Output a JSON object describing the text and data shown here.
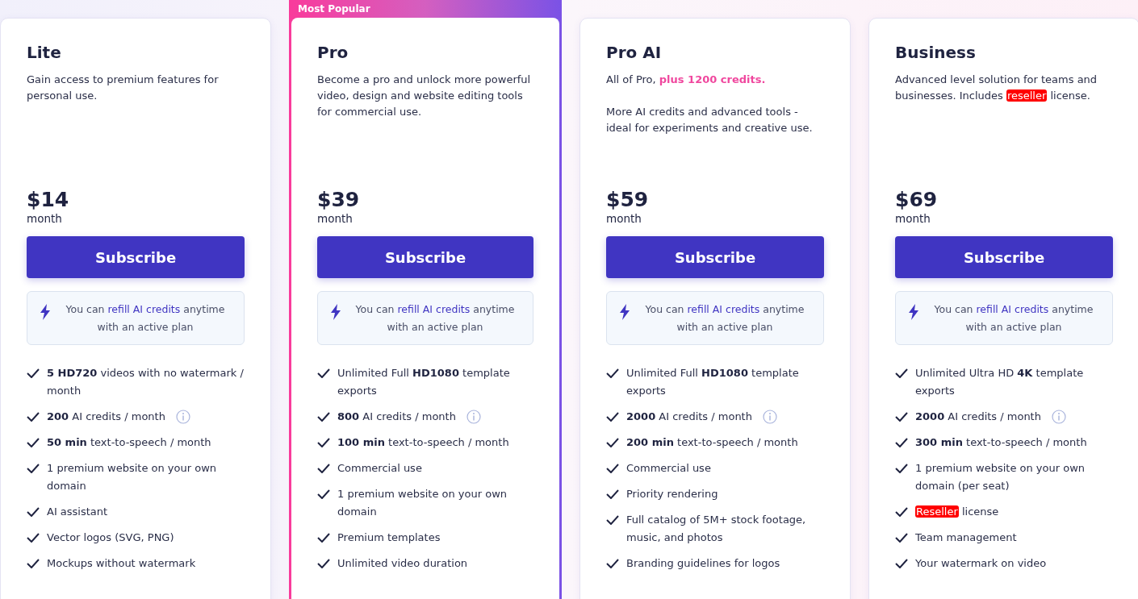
{
  "plans": [
    {
      "name": "Lite",
      "description": [
        [
          {
            "text": "Gain access to premium features for personal use.",
            "kind": "plain"
          }
        ]
      ],
      "price": "$14",
      "period": "month",
      "button": "Subscribe",
      "refill_note": [
        {
          "text": "You can ",
          "kind": "plain"
        },
        {
          "text": "refill AI credits",
          "kind": "link"
        },
        {
          "text": " anytime with an active plan",
          "kind": "plain"
        }
      ],
      "features": [
        {
          "parts": [
            {
              "text": "5 HD720",
              "kind": "bold"
            },
            {
              "text": " videos with no watermark / month",
              "kind": "plain"
            }
          ],
          "info": false
        },
        {
          "parts": [
            {
              "text": "200",
              "kind": "bold"
            },
            {
              "text": " AI credits / month",
              "kind": "plain"
            }
          ],
          "info": true
        },
        {
          "parts": [
            {
              "text": "50 min",
              "kind": "bold"
            },
            {
              "text": " text-to-speech / month",
              "kind": "plain"
            }
          ],
          "info": false
        },
        {
          "parts": [
            {
              "text": "1 premium website on your own domain",
              "kind": "plain"
            }
          ],
          "info": false
        },
        {
          "parts": [
            {
              "text": "AI assistant",
              "kind": "plain"
            }
          ],
          "info": false
        },
        {
          "parts": [
            {
              "text": "Vector logos (SVG, PNG)",
              "kind": "plain"
            }
          ],
          "info": false
        },
        {
          "parts": [
            {
              "text": "Mockups without watermark",
              "kind": "plain"
            }
          ],
          "info": false
        }
      ]
    },
    {
      "name": "Pro",
      "badge": "Most Popular",
      "description": [
        [
          {
            "text": "Become a pro and unlock more powerful video, design and website editing tools for commercial use.",
            "kind": "plain"
          }
        ]
      ],
      "price": "$39",
      "period": "month",
      "button": "Subscribe",
      "refill_note": [
        {
          "text": "You can ",
          "kind": "plain"
        },
        {
          "text": "refill AI credits",
          "kind": "link"
        },
        {
          "text": " anytime with an active plan",
          "kind": "plain"
        }
      ],
      "features": [
        {
          "parts": [
            {
              "text": "Unlimited Full ",
              "kind": "plain"
            },
            {
              "text": "HD1080",
              "kind": "bold"
            },
            {
              "text": " template exports",
              "kind": "plain"
            }
          ],
          "info": false
        },
        {
          "parts": [
            {
              "text": "800",
              "kind": "bold"
            },
            {
              "text": " AI credits / month",
              "kind": "plain"
            }
          ],
          "info": true
        },
        {
          "parts": [
            {
              "text": "100 min",
              "kind": "bold"
            },
            {
              "text": " text-to-speech / month",
              "kind": "plain"
            }
          ],
          "info": false
        },
        {
          "parts": [
            {
              "text": "Commercial use",
              "kind": "plain"
            }
          ],
          "info": false
        },
        {
          "parts": [
            {
              "text": "1 premium website on your own domain",
              "kind": "plain"
            }
          ],
          "info": false
        },
        {
          "parts": [
            {
              "text": "Premium templates",
              "kind": "plain"
            }
          ],
          "info": false
        },
        {
          "parts": [
            {
              "text": "Unlimited video duration",
              "kind": "plain"
            }
          ],
          "info": false
        }
      ]
    },
    {
      "name": "Pro AI",
      "description": [
        [
          {
            "text": "All of Pro, ",
            "kind": "plain"
          },
          {
            "text": "plus 1200 credits.",
            "kind": "accent"
          }
        ],
        [
          {
            "text": "More AI credits and advanced tools - ideal for experiments and creative use.",
            "kind": "plain"
          }
        ]
      ],
      "price": "$59",
      "period": "month",
      "button": "Subscribe",
      "refill_note": [
        {
          "text": "You can ",
          "kind": "plain"
        },
        {
          "text": "refill AI credits",
          "kind": "link"
        },
        {
          "text": " anytime with an active plan",
          "kind": "plain"
        }
      ],
      "features": [
        {
          "parts": [
            {
              "text": "Unlimited Full ",
              "kind": "plain"
            },
            {
              "text": "HD1080",
              "kind": "bold"
            },
            {
              "text": " template exports",
              "kind": "plain"
            }
          ],
          "info": false
        },
        {
          "parts": [
            {
              "text": "2000",
              "kind": "bold"
            },
            {
              "text": " AI credits / month",
              "kind": "plain"
            }
          ],
          "info": true
        },
        {
          "parts": [
            {
              "text": "200 min",
              "kind": "bold"
            },
            {
              "text": " text-to-speech / month",
              "kind": "plain"
            }
          ],
          "info": false
        },
        {
          "parts": [
            {
              "text": "Commercial use",
              "kind": "plain"
            }
          ],
          "info": false
        },
        {
          "parts": [
            {
              "text": "Priority rendering",
              "kind": "plain"
            }
          ],
          "info": false
        },
        {
          "parts": [
            {
              "text": "Full catalog of 5M+ stock footage, music, and photos",
              "kind": "plain"
            }
          ],
          "info": false
        },
        {
          "parts": [
            {
              "text": "Branding guidelines for logos",
              "kind": "plain"
            }
          ],
          "info": false
        }
      ]
    },
    {
      "name": "Business",
      "description": [
        [
          {
            "text": "Advanced level solution for teams and businesses. Includes ",
            "kind": "plain"
          },
          {
            "text": "reseller",
            "kind": "highlight"
          },
          {
            "text": " license.",
            "kind": "plain"
          }
        ]
      ],
      "price": "$69",
      "period": "month",
      "button": "Subscribe",
      "refill_note": [
        {
          "text": "You can ",
          "kind": "plain"
        },
        {
          "text": "refill AI credits",
          "kind": "link"
        },
        {
          "text": " anytime with an active plan",
          "kind": "plain"
        }
      ],
      "features": [
        {
          "parts": [
            {
              "text": "Unlimited Ultra HD ",
              "kind": "plain"
            },
            {
              "text": "4K",
              "kind": "bold"
            },
            {
              "text": " template exports",
              "kind": "plain"
            }
          ],
          "info": false
        },
        {
          "parts": [
            {
              "text": "2000",
              "kind": "bold"
            },
            {
              "text": " AI credits / month",
              "kind": "plain"
            }
          ],
          "info": true
        },
        {
          "parts": [
            {
              "text": "300 min",
              "kind": "bold"
            },
            {
              "text": " text-to-speech / month",
              "kind": "plain"
            }
          ],
          "info": false
        },
        {
          "parts": [
            {
              "text": "1 premium website on your own domain (per seat)",
              "kind": "plain"
            }
          ],
          "info": false
        },
        {
          "parts": [
            {
              "text": "Reseller",
              "kind": "highlight"
            },
            {
              "text": " license",
              "kind": "plain"
            }
          ],
          "info": false
        },
        {
          "parts": [
            {
              "text": "Team management",
              "kind": "plain"
            }
          ],
          "info": false
        },
        {
          "parts": [
            {
              "text": "Your watermark on video",
              "kind": "plain"
            }
          ],
          "info": false
        }
      ]
    }
  ]
}
